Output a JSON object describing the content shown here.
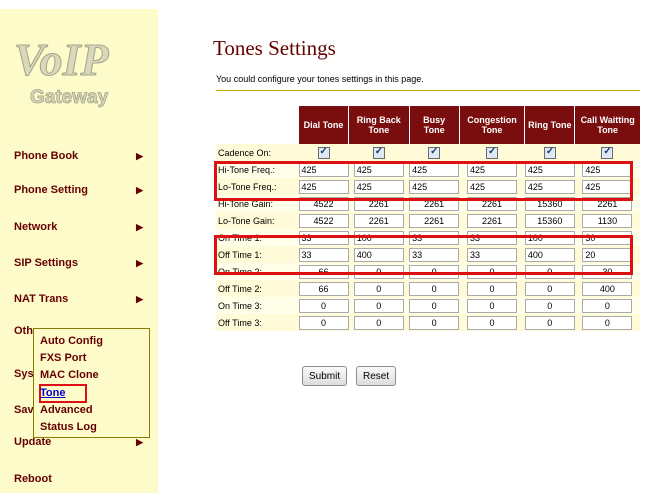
{
  "logo": {
    "text_main": "VoIP",
    "text_sub": "Gateway"
  },
  "sidebar": {
    "items": [
      {
        "label": "Phone Book",
        "has_arrow": true
      },
      {
        "label": "Phone Setting",
        "has_arrow": true
      },
      {
        "label": "Network",
        "has_arrow": true
      },
      {
        "label": "SIP Settings",
        "has_arrow": true
      },
      {
        "label": "NAT Trans",
        "has_arrow": true
      },
      {
        "label": "Oth",
        "has_arrow": false
      },
      {
        "label": "Sys",
        "has_arrow": false
      },
      {
        "label": "Sav",
        "has_arrow": false
      },
      {
        "label": "Update",
        "has_arrow": true
      },
      {
        "label": "Reboot",
        "has_arrow": false
      }
    ],
    "submenu": [
      {
        "label": "Auto Config"
      },
      {
        "label": "FXS Port"
      },
      {
        "label": "MAC Clone"
      },
      {
        "label": "Tone",
        "active": true
      },
      {
        "label": "Advanced"
      },
      {
        "label": "Status Log"
      }
    ]
  },
  "page": {
    "title": "Tones Settings",
    "description": "You could configure your tones settings in this page."
  },
  "table": {
    "headers": [
      "Dial Tone",
      "Ring Back Tone",
      "Busy Tone",
      "Congestion Tone",
      "Ring Tone",
      "Call Waitting Tone"
    ],
    "cadence_label": "Cadence On:",
    "cadence_checked": [
      true,
      true,
      true,
      true,
      true,
      true
    ],
    "rows": [
      {
        "label": "Hi-Tone Freq.:",
        "values": [
          "425",
          "425",
          "425",
          "425",
          "425",
          "425"
        ]
      },
      {
        "label": "Lo-Tone Freq.:",
        "values": [
          "425",
          "425",
          "425",
          "425",
          "425",
          "425"
        ]
      },
      {
        "label": "Hi-Tone Gain:",
        "values": [
          "4522",
          "2261",
          "2261",
          "2261",
          "15360",
          "2261"
        ]
      },
      {
        "label": "Lo-Tone Gain:",
        "values": [
          "4522",
          "2261",
          "2261",
          "2261",
          "15360",
          "1130"
        ]
      },
      {
        "label": "On Time 1:",
        "values": [
          "33",
          "100",
          "33",
          "33",
          "100",
          "30"
        ]
      },
      {
        "label": "Off Time 1:",
        "values": [
          "33",
          "400",
          "33",
          "33",
          "400",
          "20"
        ]
      },
      {
        "label": "On Time 2:",
        "values": [
          "66",
          "0",
          "0",
          "0",
          "0",
          "30"
        ]
      },
      {
        "label": "Off Time 2:",
        "values": [
          "66",
          "0",
          "0",
          "0",
          "0",
          "400"
        ]
      },
      {
        "label": "On Time 3:",
        "values": [
          "0",
          "0",
          "0",
          "0",
          "0",
          "0"
        ]
      },
      {
        "label": "Off Time 3:",
        "values": [
          "0",
          "0",
          "0",
          "0",
          "0",
          "0"
        ]
      }
    ]
  },
  "buttons": {
    "submit": "Submit",
    "reset": "Reset"
  },
  "colors": {
    "accent_dark_red": "#7a0d0d",
    "sidebar_bg": "#fefbca",
    "highlight_red": "#dd1111"
  }
}
